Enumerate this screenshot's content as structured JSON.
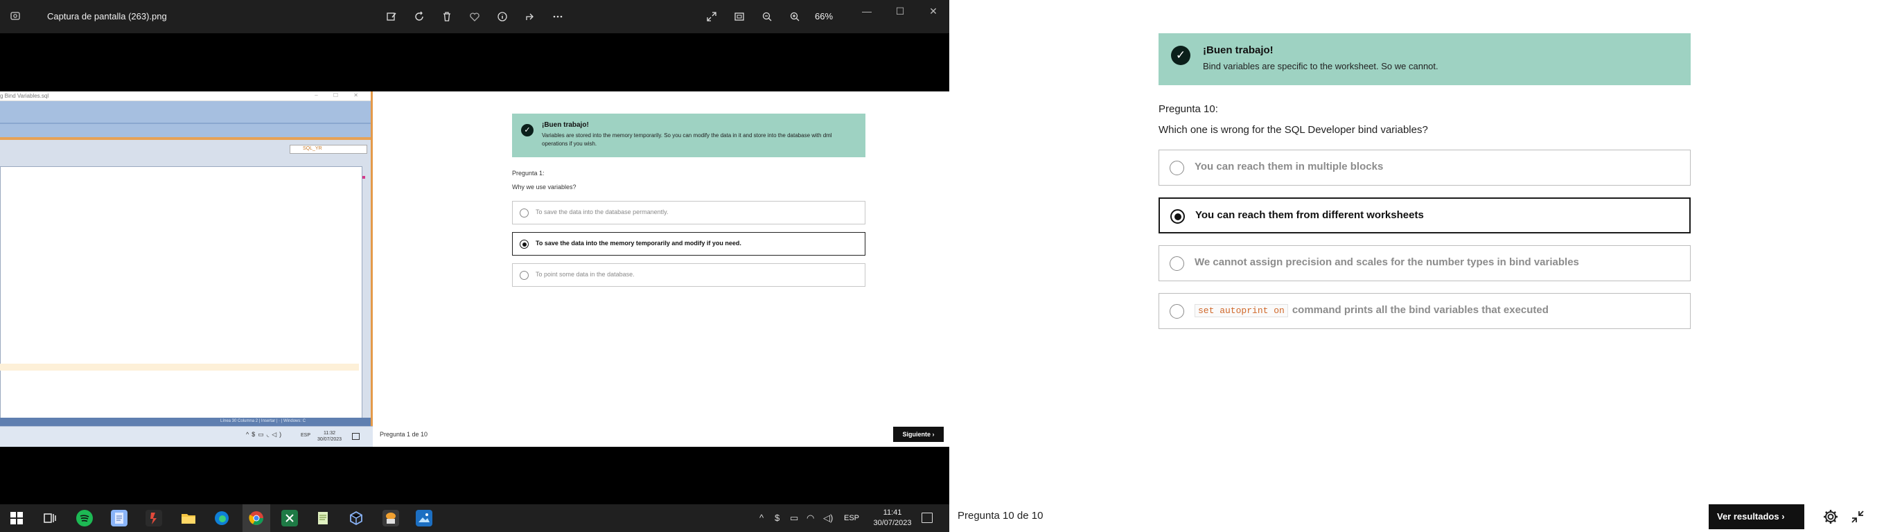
{
  "viewer": {
    "filename": "Captura de pantalla (263).png",
    "zoom": "66%",
    "tools": [
      "edit-icon",
      "rotate-icon",
      "delete-icon",
      "favorite-icon",
      "info-icon",
      "share-icon",
      "more-icon"
    ],
    "view_tools": [
      "fullscreen-icon",
      "fit-icon",
      "zoom-out-icon",
      "zoom-in-icon"
    ],
    "window_controls": {
      "minimize": "—",
      "maximize": "☐",
      "close": "✕"
    }
  },
  "screenshot": {
    "sqldev": {
      "title": "g Bind Variables.sql",
      "connection": "SQL_YR",
      "status": "Línea 30 Columna 2   |   Insertar   |   ·   |   Windows: C",
      "lang": "ESP",
      "time": "11:32",
      "date": "30/07/2023"
    },
    "quiz": {
      "banner_title": "¡Buen trabajo!",
      "banner_text": "Variables are stored into the memory temporarily. So you can modify the data in it and store into the database with dml operations if you wish.",
      "question_number": "Pregunta 1:",
      "question": "Why we use variables?",
      "options": [
        {
          "text": "To save the data into the database permanently.",
          "selected": false
        },
        {
          "text": "To save the data into the memory temporarily and modify if you need.",
          "selected": true
        },
        {
          "text": "To point some data in the database.",
          "selected": false
        }
      ],
      "footer": "Pregunta 1 de 10",
      "next_label": "Siguiente ›"
    }
  },
  "taskbar": {
    "apps": [
      "start-icon",
      "task-view-icon",
      "spotify-icon",
      "notepad-icon",
      "app-icon",
      "file-explorer-icon",
      "edge-icon",
      "chrome-icon",
      "excel-icon",
      "notepad-plus-icon",
      "virtualbox-icon",
      "sql-developer-icon",
      "photos-icon"
    ],
    "lang": "ESP",
    "time": "11:41",
    "date": "30/07/2023"
  },
  "quiz": {
    "banner_title": "¡Buen trabajo!",
    "banner_text": "Bind variables are specific to the worksheet. So we cannot.",
    "question_number": "Pregunta 10:",
    "question": "Which one is wrong for the SQL Developer bind variables?",
    "options": [
      {
        "text": "You can reach them in multiple blocks",
        "selected": false
      },
      {
        "text": "You can reach them from different worksheets",
        "selected": true
      },
      {
        "text": "We cannot assign precision and scales for the number types in bind variables",
        "selected": false
      },
      {
        "code": "set autoprint on",
        "text": "command prints all the bind variables that executed",
        "selected": false
      }
    ],
    "footer": "Pregunta 10 de 10",
    "results_label": "Ver resultados  ›"
  },
  "colors": {
    "banner": "#9ed2c2",
    "viewer_bar": "#1f1f1f",
    "taskbar": "#202020",
    "accent_orange": "#e49a4a"
  }
}
